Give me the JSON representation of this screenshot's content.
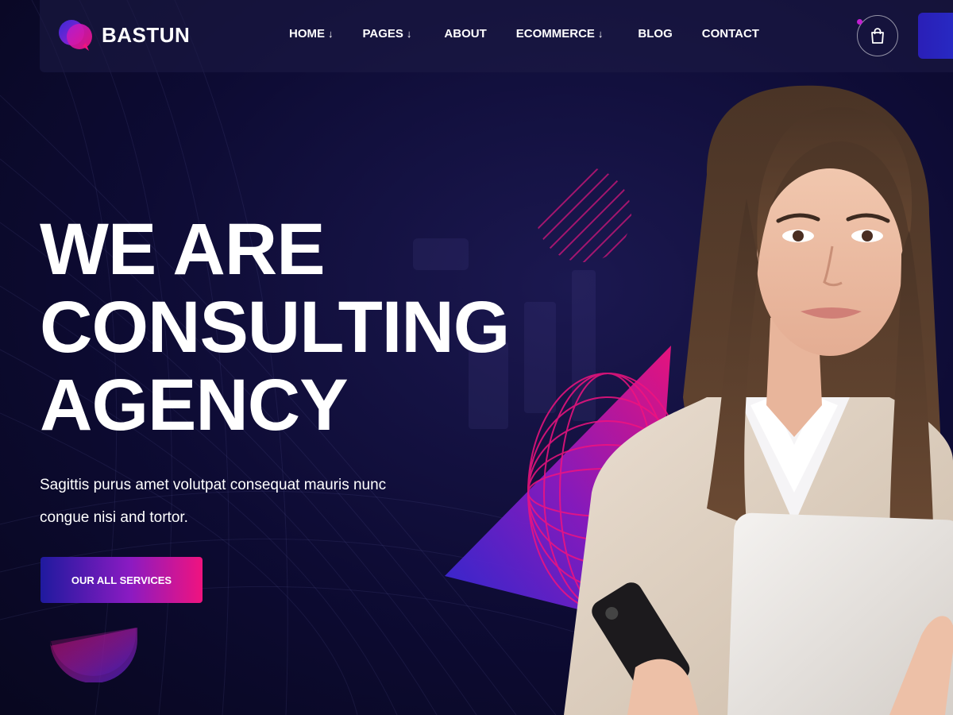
{
  "brand": {
    "name": "BASTUN"
  },
  "nav": {
    "items": [
      {
        "label": "HOME",
        "has_dropdown": true,
        "arrow": "↓"
      },
      {
        "label": "PAGES",
        "has_dropdown": true,
        "arrow": "↓"
      },
      {
        "label": "ABOUT",
        "has_dropdown": false,
        "arrow": ""
      },
      {
        "label": "ECOMMERCE",
        "has_dropdown": true,
        "arrow": "↓"
      },
      {
        "label": "BLOG",
        "has_dropdown": false,
        "arrow": ""
      },
      {
        "label": "CONTACT",
        "has_dropdown": false,
        "arrow": ""
      }
    ],
    "cart_icon": "shopping-bag-icon"
  },
  "hero": {
    "title_lines": [
      "WE ARE",
      "CONSULTING",
      "AGENCY"
    ],
    "subtitle_lines": [
      "Sagittis purus amet volutpat consequat mauris nunc",
      "congue nisi and tortor."
    ],
    "cta_label": "OUR ALL SERVICES"
  },
  "colors": {
    "background": "#0d0b33",
    "accent_blue": "#2a1fb7",
    "accent_purple": "#8a1bc2",
    "accent_pink": "#f0137f"
  }
}
